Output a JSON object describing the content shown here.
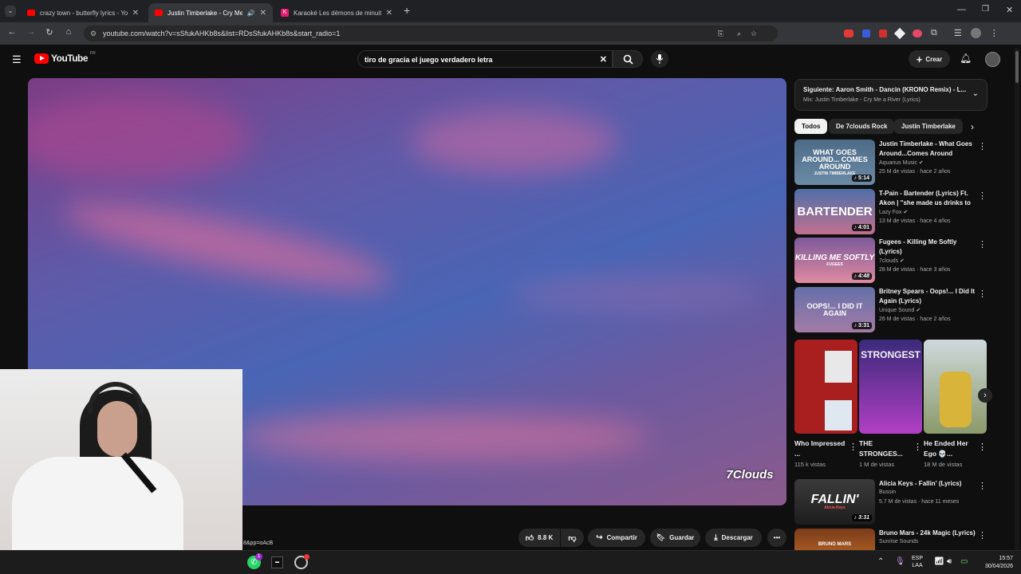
{
  "browser": {
    "tabs": [
      {
        "title": "crazy town - butterfly lyrics - Yo"
      },
      {
        "title": "Justin Timberlake - Cry Me"
      },
      {
        "title": "Karaoké Les démons de minuit"
      }
    ],
    "new_tab": "+",
    "url": "youtube.com/watch?v=sSfukAHKb8s&list=RDsSfukAHKb8s&start_radio=1"
  },
  "youtube": {
    "logo": "YouTube",
    "region": "FR",
    "search_value": "tiro de gracia el juego verdadero letra",
    "create_label": "Crear"
  },
  "player": {
    "watermark": "7Clouds",
    "status_url": "8&pp=oAcB"
  },
  "actions": {
    "likes": "8.8 K",
    "share": "Compartir",
    "save": "Guardar",
    "download": "Descargar"
  },
  "up_next": {
    "title": "Siguiente: Aaron Smith - Dancin (KRONO Remix) - L...",
    "subtitle": "Mix: Justin Timberlake - Cry Me a River (Lyrics)"
  },
  "chips": [
    "Todos",
    "De 7clouds Rock",
    "Justin Timberlake"
  ],
  "videos": [
    {
      "title": "Justin Timberlake - What Goes Around...Comes Around (Lyrics)",
      "channel": "Aquarius Music",
      "meta": "25 M de vistas · hace 2 años",
      "duration": "5:14",
      "thumb_text": "WHAT GOES AROUND... COMES AROUND",
      "thumb_sub": "JUSTIN TIMBERLAKE"
    },
    {
      "title": "T-Pain - Bartender (Lyrics) Ft. Akon | \"she made us drinks to ...",
      "channel": "Lazy Fox",
      "meta": "13 M de vistas · hace 4 años",
      "duration": "4:01",
      "thumb_text": "BARTENDER",
      "thumb_sub": ""
    },
    {
      "title": "Fugees - Killing Me Softly (Lyrics)",
      "channel": "7clouds",
      "meta": "28 M de vistas · hace 3 años",
      "duration": "4:48",
      "thumb_text": "KILLING ME SOFTLY",
      "thumb_sub": "FUGEES"
    },
    {
      "title": "Britney Spears - Oops!... I Did It Again (Lyrics)",
      "channel": "Unique Sound",
      "meta": "26 M de vistas · hace 2 años",
      "duration": "3:31",
      "thumb_text": "OOPS!... I DID IT AGAIN",
      "thumb_sub": ""
    }
  ],
  "shorts": [
    {
      "title": "Who Impressed ...",
      "views": "115 k vistas"
    },
    {
      "title": "THE STRONGES...",
      "views": "1 M de vistas",
      "thumb_text": "STRONGEST"
    },
    {
      "title": "He Ended Her Ego 💀...",
      "views": "18 M de vistas"
    }
  ],
  "videos2": [
    {
      "title": "Alicia Keys - Fallin' (Lyrics)",
      "channel": "Bussin",
      "meta": "5.7 M de vistas · hace 11 meses",
      "duration": "3:31",
      "thumb_text": "FALLIN'",
      "thumb_sub": "Alicia Keys"
    },
    {
      "title": "Bruno Mars - 24k Magic (Lyrics)",
      "channel": "Sunrise Sounds",
      "meta": "",
      "duration": "",
      "thumb_text": "BRUNO MARS",
      "thumb_sub": ""
    }
  ],
  "taskbar": {
    "lang": "ESP",
    "lang_sub": "LAA",
    "time": "15:57",
    "date": "30/04/2026",
    "whatsapp_badge": "1"
  }
}
